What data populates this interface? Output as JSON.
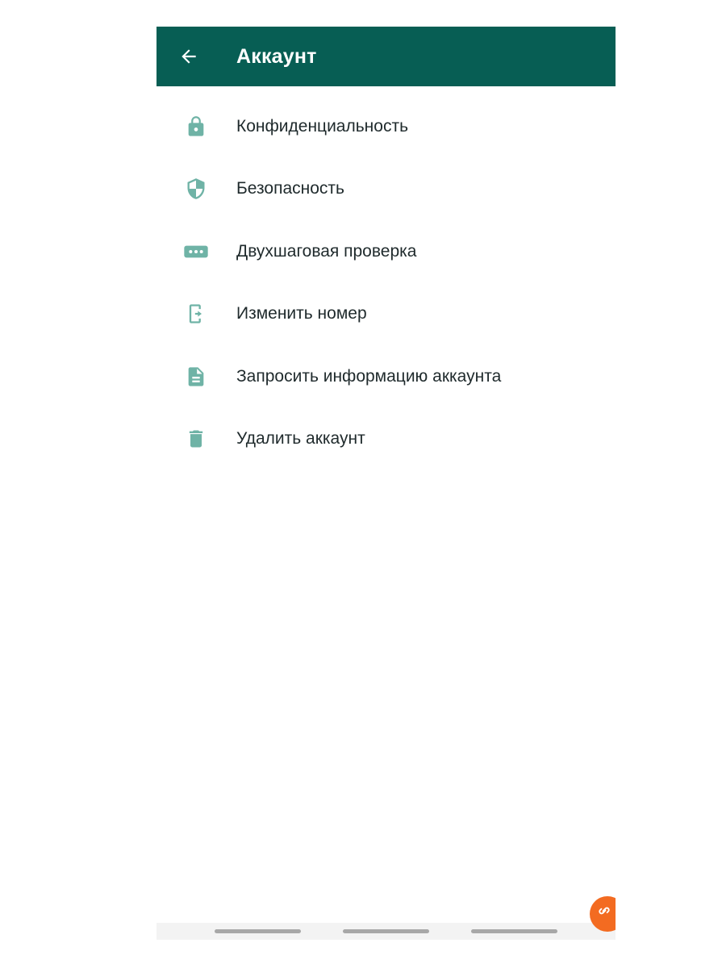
{
  "appbar": {
    "title": "Аккаунт",
    "back_icon": "arrow-left-icon",
    "background": "#075e54"
  },
  "menu": {
    "icon_color": "#6fb3a6",
    "items": [
      {
        "label": "Конфиденциальность",
        "icon": "lock-icon"
      },
      {
        "label": "Безопасность",
        "icon": "shield-icon"
      },
      {
        "label": "Двухшаговая проверка",
        "icon": "password-dots-icon"
      },
      {
        "label": "Изменить номер",
        "icon": "phone-change-icon"
      },
      {
        "label": "Запросить информацию аккаунта",
        "icon": "document-icon"
      },
      {
        "label": "Удалить аккаунт",
        "icon": "trash-icon"
      }
    ]
  },
  "navbar": {
    "handles": [
      "recent-apps",
      "home",
      "back"
    ]
  },
  "floating_badge": {
    "icon": "link-icon",
    "color": "#f36b21"
  }
}
